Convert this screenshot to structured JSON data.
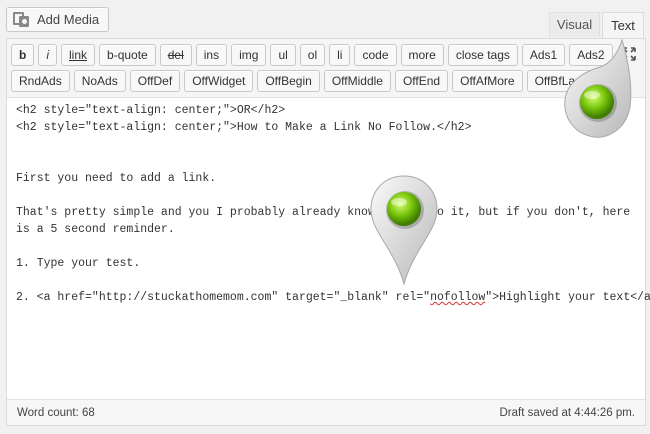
{
  "media": {
    "add_media_label": "Add Media",
    "icon": "media-icon"
  },
  "tabs": {
    "visual": "Visual",
    "text": "Text"
  },
  "toolbar": {
    "row1": [
      "b",
      "i",
      "link",
      "b-quote",
      "del",
      "ins",
      "img",
      "ul",
      "ol",
      "li",
      "code",
      "more",
      "close tags",
      "Ads1",
      "Ads2"
    ],
    "row2": [
      "RndAds",
      "NoAds",
      "OffDef",
      "OffWidget",
      "OffBegin",
      "OffMiddle",
      "OffEnd",
      "OffAfMore",
      "OffBfLastPara"
    ],
    "expand_icon": "fullscreen-icon"
  },
  "content": {
    "line1": "<h2 style=\"text-align: center;\">OR</h2>",
    "line2": "<h2 style=\"text-align: center;\">How to Make a Link No Follow.</h2>",
    "line3": "First you need to add a link.",
    "line4": "That's pretty simple and you I probably already know how to do it, but if you don't, here is a 5 second reminder.",
    "line5": "1. Type your test.",
    "line6_before": "2. <a href=\"http://stuckathomemom.com\" target=\"_blank\" rel=\"",
    "line6_underlined": "nofollow",
    "line6_after": "\">Highlight your text</a>."
  },
  "status": {
    "word_count": "Word count: 68",
    "draft_saved": "Draft saved at 4:44:26 pm."
  },
  "colors": {
    "pin_green": "#7ac70c",
    "pin_body": "#d9d9d9"
  }
}
